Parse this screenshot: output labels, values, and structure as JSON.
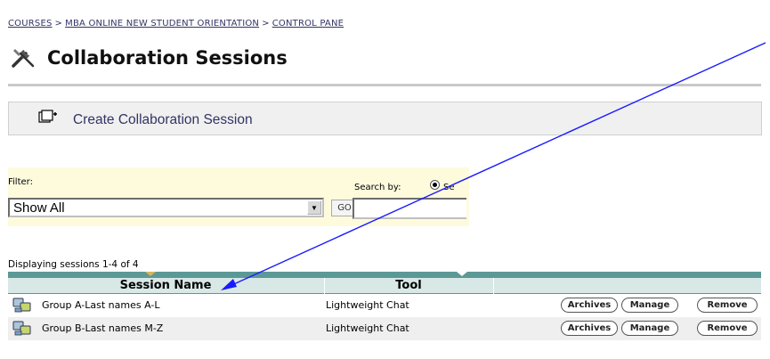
{
  "breadcrumb": {
    "items": [
      "COURSES",
      "MBA ONLINE NEW STUDENT ORIENTATION",
      "CONTROL PANE"
    ],
    "separator": ">"
  },
  "page": {
    "title": "Collaboration Sessions"
  },
  "actions": {
    "create_label": "Create Collaboration Session"
  },
  "filter": {
    "label": "Filter:",
    "selected": "Show All",
    "go_label": "GO",
    "search_by_label": "Search by:",
    "radio_label": "Se",
    "search_value": ""
  },
  "listing": {
    "count_text": "Displaying sessions 1-4 of 4",
    "columns": [
      "Session Name",
      "Tool"
    ],
    "rows": [
      {
        "name": "Group A-Last names A-L",
        "tool": "Lightweight Chat",
        "buttons": [
          "Archives",
          "Manage",
          "Remove"
        ]
      },
      {
        "name": "Group B-Last names M-Z",
        "tool": "Lightweight Chat",
        "buttons": [
          "Archives",
          "Manage",
          "Remove"
        ]
      }
    ]
  },
  "colors": {
    "accent": "#5c9896",
    "header_bg": "#d8e8e6",
    "filter_bg": "#fdfbdc",
    "link": "#333366",
    "annotation_arrow": "#1a1aff"
  },
  "icons": {
    "title": "tools-icon",
    "create": "create-session-icon",
    "row": "chat-session-icon"
  }
}
